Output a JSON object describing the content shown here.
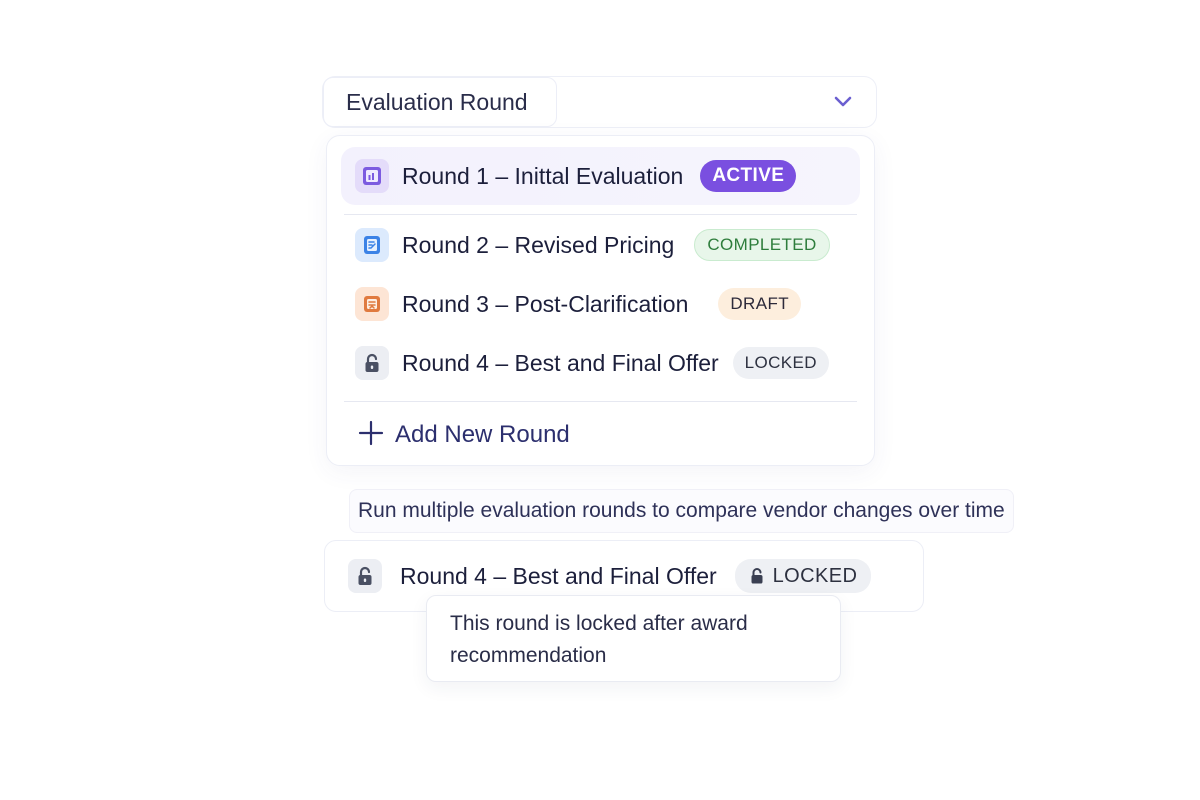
{
  "select": {
    "label": "Evaluation Round",
    "chevron_icon": "chevron-down-icon"
  },
  "dropdown": {
    "items": [
      {
        "label": "Round 1 – Inittal Evaluation",
        "badge": "ACTIVE",
        "status": "active",
        "icon": "document-chart-icon",
        "icon_color": "#7c5be0"
      },
      {
        "label": "Round 2 – Revised Pricing",
        "badge": "COMPLETED",
        "status": "completed",
        "icon": "document-edit-icon",
        "icon_color": "#3b82e6"
      },
      {
        "label": "Round 3 – Post-Clarification",
        "badge": "DRAFT",
        "status": "draft",
        "icon": "document-draft-icon",
        "icon_color": "#e07a3f"
      },
      {
        "label": "Round 4 – Best and Final Offer",
        "badge": "LOCKED",
        "status": "locked",
        "icon": "lock-icon",
        "icon_color": "#4a5063"
      }
    ],
    "add_label": "Add New Round",
    "add_icon": "plus-icon"
  },
  "caption": "Run multiple evaluation rounds to compare vendor changes over time",
  "locked_card": {
    "label": "Round 4 – Best and Final Offer",
    "badge": "LOCKED",
    "icon": "lock-icon"
  },
  "tooltip": {
    "text": "This round is locked after award recommendation"
  },
  "colors": {
    "accent": "#7a4fe0",
    "completed_bg": "#e8f6ea",
    "completed_text": "#2e7d3c",
    "draft_bg": "#fdeedd",
    "locked_bg": "#eef0f4"
  }
}
